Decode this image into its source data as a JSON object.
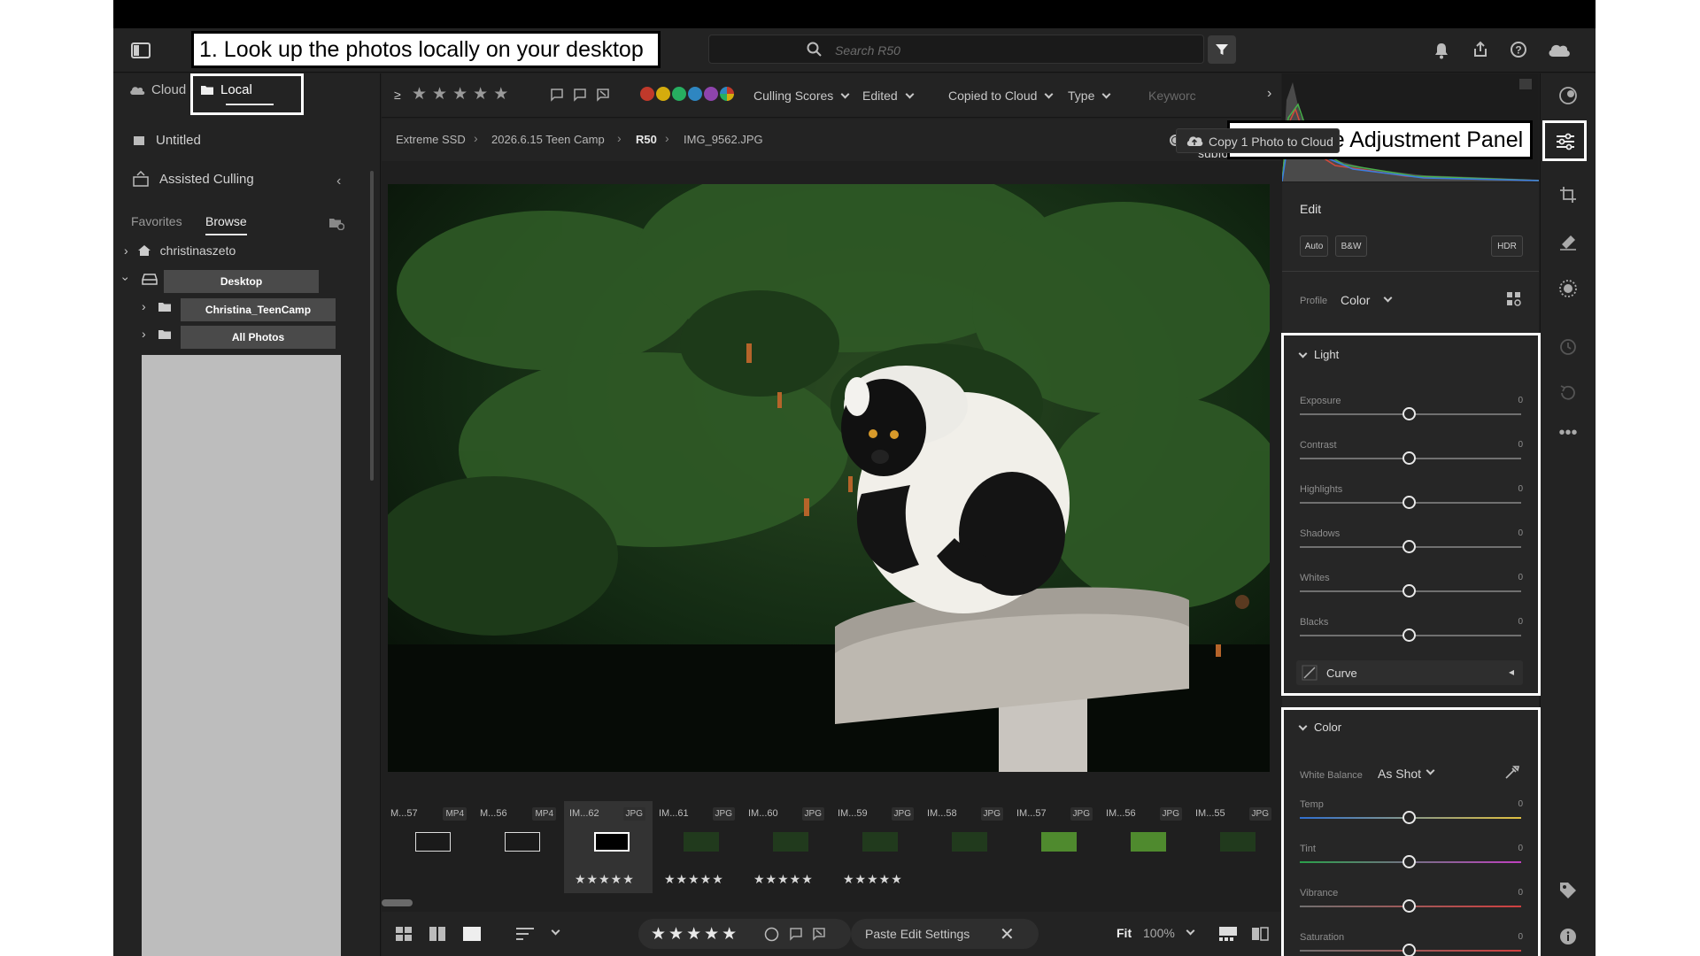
{
  "annotations": {
    "step1": "1. Look up the photos locally on your desktop",
    "step2": "2. Click the Adjustment Panel"
  },
  "header": {
    "search_placeholder": "Search R50"
  },
  "left_panel": {
    "cloud_tab": "Cloud",
    "local_tab": "Local",
    "untitled": "Untitled",
    "assisted_culling": "Assisted Culling",
    "tab_favorites": "Favorites",
    "tab_browse": "Browse",
    "tree": {
      "user": "christinaszeto",
      "desktop": "Desktop",
      "folder1": "Christina_TeenCamp",
      "folder2": "All Photos"
    }
  },
  "filter_bar": {
    "rating_op": "≥",
    "culling_scores": "Culling Scores",
    "edited": "Edited",
    "copied_to_cloud": "Copied to Cloud",
    "type": "Type",
    "keywords": "Keyworc",
    "colors": [
      "#c0392b",
      "#d4ac0d",
      "#27ae60",
      "#2e86c1",
      "#8e44ad"
    ]
  },
  "breadcrumb": {
    "items": [
      "Extreme SSD",
      "2026.6.15 Teen Camp",
      "R50",
      "IMG_9562.JPG"
    ],
    "include_subfolders": "Include subfolders",
    "copy_button": "Copy 1 Photo to Cloud"
  },
  "filmstrip": [
    {
      "name": "M...57",
      "type": "MP4",
      "stars": "",
      "thumb": "video"
    },
    {
      "name": "M...56",
      "type": "MP4",
      "stars": "",
      "thumb": "video"
    },
    {
      "name": "IM...62",
      "type": "JPG",
      "stars": "★★★★★",
      "thumb": "sel"
    },
    {
      "name": "IM...61",
      "type": "JPG",
      "stars": "★★★★★",
      "thumb": "dark"
    },
    {
      "name": "IM...60",
      "type": "JPG",
      "stars": "★★★★★",
      "thumb": "dark"
    },
    {
      "name": "IM...59",
      "type": "JPG",
      "stars": "★★★★★",
      "thumb": "dark"
    },
    {
      "name": "IM...58",
      "type": "JPG",
      "stars": "",
      "thumb": "dark"
    },
    {
      "name": "IM...57",
      "type": "JPG",
      "stars": "",
      "thumb": "green"
    },
    {
      "name": "IM...56",
      "type": "JPG",
      "stars": "",
      "thumb": "green"
    },
    {
      "name": "IM...55",
      "type": "JPG",
      "stars": "",
      "thumb": "dark"
    }
  ],
  "bottom_bar": {
    "stars": "★★★★★",
    "paste": "Paste Edit Settings",
    "fit": "Fit",
    "zoom": "100%"
  },
  "edit_panel": {
    "title": "Edit",
    "auto": "Auto",
    "bw": "B&W",
    "hdr": "HDR",
    "profile_label": "Profile",
    "profile_value": "Color",
    "light_title": "Light",
    "light_sliders": [
      {
        "label": "Exposure",
        "value": "0"
      },
      {
        "label": "Contrast",
        "value": "0"
      },
      {
        "label": "Highlights",
        "value": "0"
      },
      {
        "label": "Shadows",
        "value": "0"
      },
      {
        "label": "Whites",
        "value": "0"
      },
      {
        "label": "Blacks",
        "value": "0"
      }
    ],
    "curve": "Curve",
    "color_title": "Color",
    "wb_label": "White Balance",
    "wb_value": "As Shot",
    "color_sliders": [
      {
        "label": "Temp",
        "value": "0"
      },
      {
        "label": "Tint",
        "value": "0"
      },
      {
        "label": "Vibrance",
        "value": "0"
      },
      {
        "label": "Saturation",
        "value": "0"
      }
    ]
  }
}
